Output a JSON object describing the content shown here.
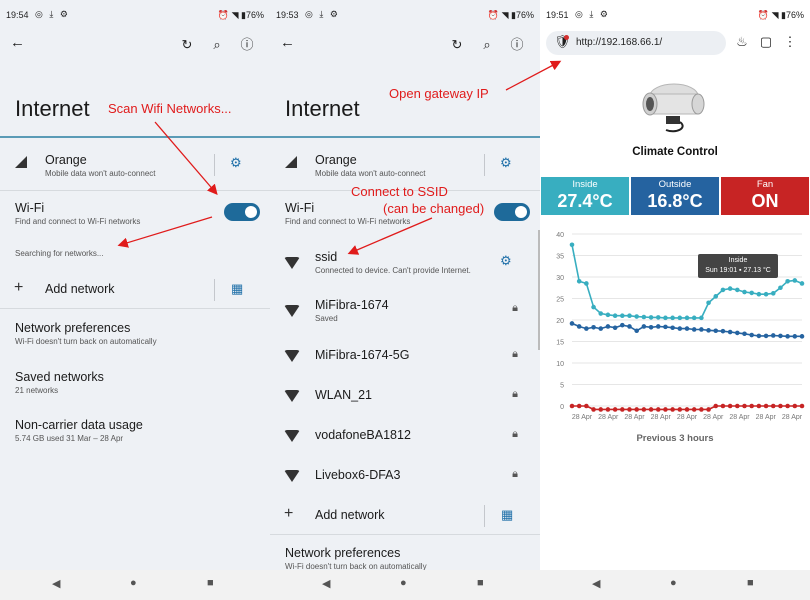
{
  "panel1": {
    "status": {
      "time": "19:54",
      "right": "⏰ ◥ ▮76%"
    },
    "title": "Internet",
    "carrier": {
      "name": "Orange",
      "sub": "Mobile data won't auto-connect"
    },
    "wifi": {
      "label": "Wi-Fi",
      "sub": "Find and connect to Wi-Fi networks",
      "searching": "Searching for networks..."
    },
    "add_network": "Add network",
    "net_prefs": {
      "label": "Network preferences",
      "sub": "Wi-Fi doesn't turn back on automatically"
    },
    "saved": {
      "label": "Saved networks",
      "sub": "21 networks"
    },
    "noncarrier": {
      "label": "Non-carrier data usage",
      "sub": "5.74 GB used 31 Mar – 28 Apr"
    }
  },
  "panel2": {
    "status": {
      "time": "19:53",
      "right": "⏰ ◥ ▮76%"
    },
    "title": "Internet",
    "carrier": {
      "name": "Orange",
      "sub": "Mobile data won't auto-connect"
    },
    "wifi": {
      "label": "Wi-Fi",
      "sub": "Find and connect to Wi-Fi networks"
    },
    "ssid": {
      "name": "ssid",
      "sub": "Connected to device. Can't provide Internet."
    },
    "networks": [
      {
        "name": "MiFibra-1674",
        "sub": "Saved"
      },
      {
        "name": "MiFibra-1674-5G",
        "sub": ""
      },
      {
        "name": "WLAN_21",
        "sub": ""
      },
      {
        "name": "vodafoneBA1812",
        "sub": ""
      },
      {
        "name": "Livebox6-DFA3",
        "sub": ""
      }
    ],
    "add_network": "Add network",
    "net_prefs": {
      "label": "Network preferences",
      "sub": "Wi-Fi doesn't turn back on automatically"
    }
  },
  "panel3": {
    "status": {
      "time": "19:51",
      "right": "⏰ ◥ ▮76%"
    },
    "url": "http://192.168.66.1/",
    "title": "Climate Control",
    "tiles": [
      {
        "label": "Inside",
        "value": "27.4°C",
        "color": "#38aec0"
      },
      {
        "label": "Outside",
        "value": "16.8°C",
        "color": "#2563a0"
      },
      {
        "label": "Fan",
        "value": "ON",
        "color": "#c72424"
      }
    ],
    "tooltip": {
      "line1": "Inside",
      "line2": "Sun 19:01 ▪ 27.13 °C"
    },
    "footer": "Previous 3 hours"
  },
  "annotations": {
    "scan": "Scan Wifi Networks...",
    "connect1": "Connect to SSID",
    "connect2": "(can be changed)",
    "gateway": "Open gateway IP"
  },
  "chart_data": {
    "type": "line",
    "ylim": [
      0,
      40
    ],
    "yticks": [
      "0",
      "5",
      "10",
      "15",
      "20",
      "25",
      "30",
      "35",
      "40"
    ],
    "xticks": [
      "28 Apr",
      "28 Apr",
      "28 Apr",
      "28 Apr",
      "28 Apr",
      "28 Apr",
      "28 Apr",
      "28 Apr",
      "28 Apr"
    ],
    "series": [
      {
        "name": "Inside",
        "color": "#38aec0",
        "values": [
          37.5,
          29,
          28.5,
          23,
          21.5,
          21.2,
          21,
          21,
          21,
          20.8,
          20.7,
          20.6,
          20.6,
          20.5,
          20.5,
          20.5,
          20.5,
          20.5,
          20.5,
          24,
          25.5,
          27,
          27.3,
          27,
          26.5,
          26.3,
          26,
          26,
          26.2,
          27.5,
          29,
          29.2,
          28.5
        ]
      },
      {
        "name": "Outside",
        "color": "#2563a0",
        "values": [
          19.2,
          18.5,
          18,
          18.3,
          18,
          18.5,
          18.2,
          18.8,
          18.5,
          17.5,
          18.5,
          18.3,
          18.5,
          18.4,
          18.2,
          18,
          18,
          17.8,
          17.8,
          17.6,
          17.5,
          17.4,
          17.2,
          17,
          16.8,
          16.5,
          16.3,
          16.3,
          16.4,
          16.3,
          16.2,
          16.2,
          16.2
        ]
      },
      {
        "name": "Fan",
        "color": "#c72424",
        "values": [
          0,
          0,
          0,
          -0.8,
          -0.8,
          -0.8,
          -0.8,
          -0.8,
          -0.8,
          -0.8,
          -0.8,
          -0.8,
          -0.8,
          -0.8,
          -0.8,
          -0.8,
          -0.8,
          -0.8,
          -0.8,
          -0.8,
          0,
          0,
          0,
          0,
          0,
          0,
          0,
          0,
          0,
          0,
          0,
          0,
          0
        ]
      }
    ]
  }
}
